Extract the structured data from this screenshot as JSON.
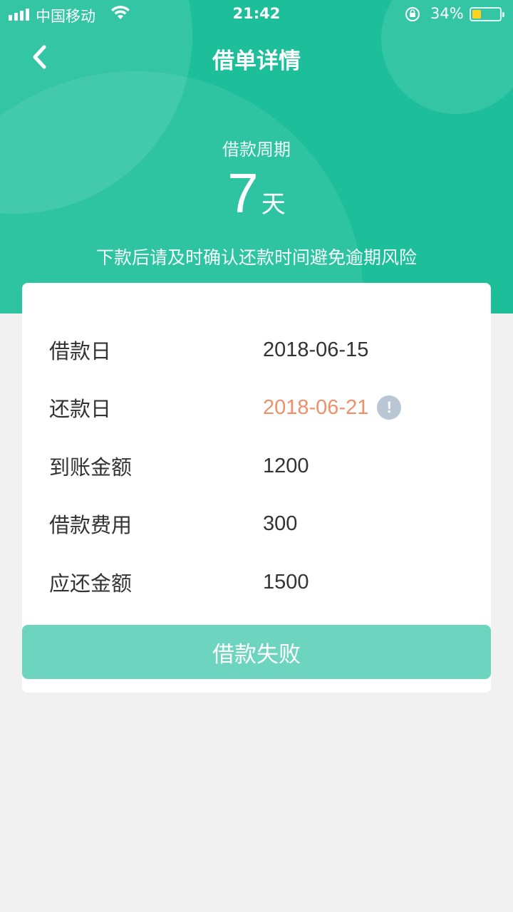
{
  "status_bar": {
    "carrier": "中国移动",
    "time": "21:42",
    "battery": "34%",
    "battery_color": "#ffd21f"
  },
  "nav": {
    "back_icon": "chevron-left-icon",
    "title": "借单详情"
  },
  "period": {
    "label": "借款周期",
    "value": "7",
    "unit": "天",
    "tip": "下款后请及时确认还款时间避免逾期风险"
  },
  "details": [
    {
      "label": "借款日",
      "value": "2018-06-15"
    },
    {
      "label": "还款日",
      "value": "2018-06-21",
      "info_icon": "!"
    },
    {
      "label": "到账金额",
      "value": "1200"
    },
    {
      "label": "借款费用",
      "value": "300"
    },
    {
      "label": "应还金额",
      "value": "1500"
    }
  ],
  "status_button": {
    "label": "借款失败"
  },
  "colors": {
    "header": "#1dbf9b",
    "button": "#6dd4bf",
    "warning": "#f0906b",
    "background": "#f1f1f1"
  }
}
